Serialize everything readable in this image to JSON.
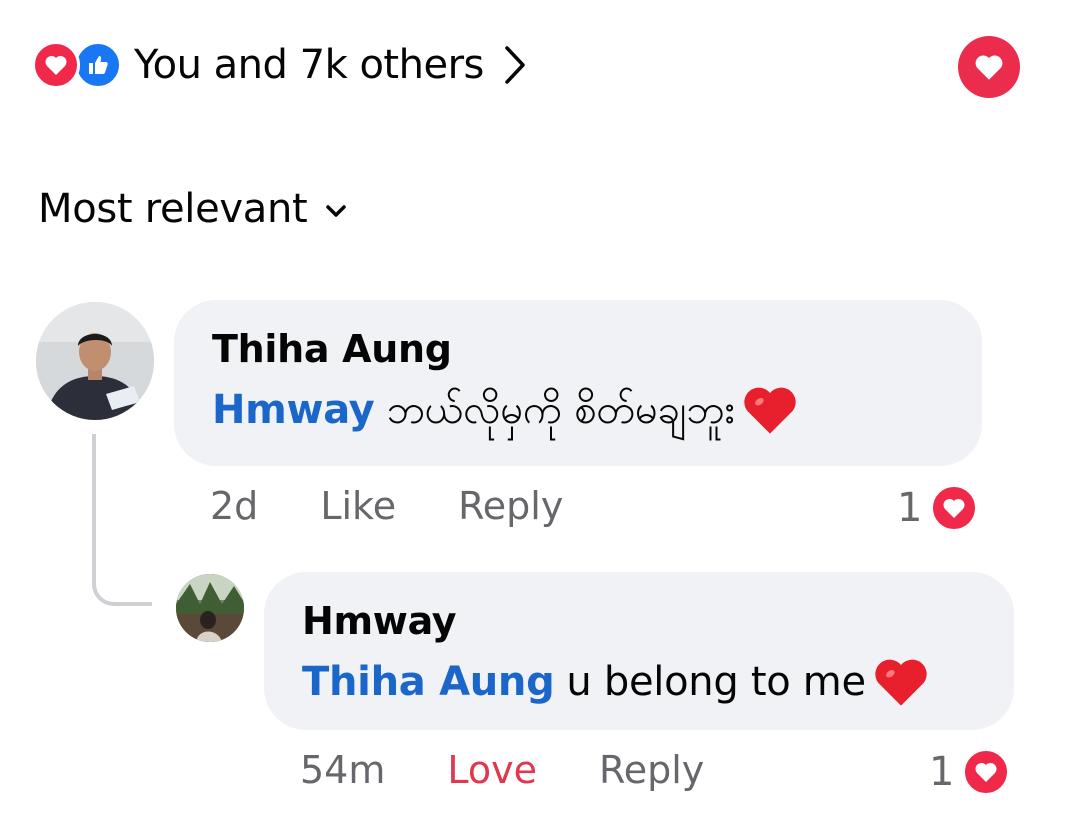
{
  "reactions_bar": {
    "summary": "You and 7k others",
    "icons": [
      "love-icon",
      "like-icon"
    ]
  },
  "sort": {
    "label": "Most relevant"
  },
  "comments": [
    {
      "author": "Thiha Aung",
      "mention": "Hmway",
      "text": "ဘယ်လိုမှကို စိတ်မချဘူး",
      "emoji": "red-heart",
      "time": "2d",
      "like_label": "Like",
      "reply_label": "Reply",
      "reaction_count": "1"
    },
    {
      "author": "Hmway",
      "mention": "Thiha Aung",
      "text": "u belong to me",
      "emoji": "red-heart",
      "time": "54m",
      "like_label": "Love",
      "reply_label": "Reply",
      "reaction_count": "1"
    }
  ],
  "colors": {
    "love": "#f02849",
    "like": "#1877f2",
    "mention": "#1b66c9",
    "bubble": "#f0f2f5",
    "meta": "#65676b",
    "love_active": "#e0384f"
  }
}
